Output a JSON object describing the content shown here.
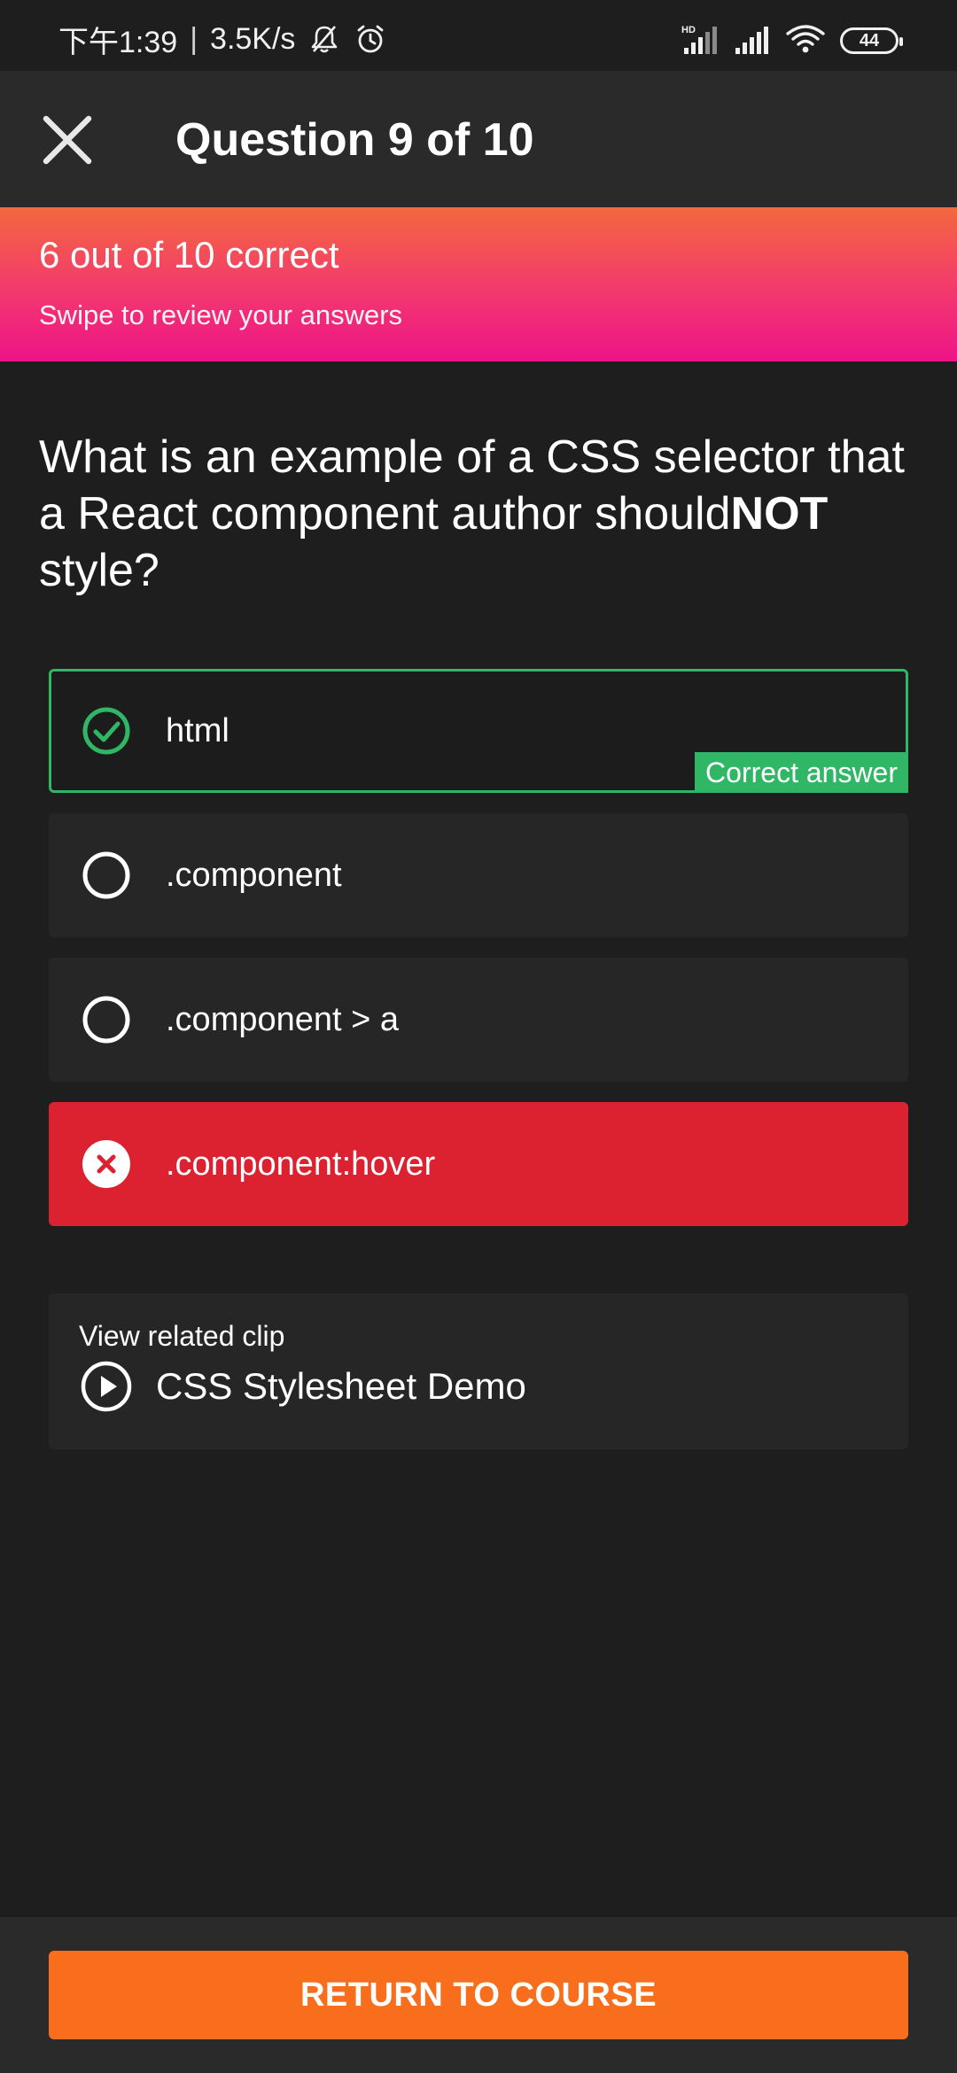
{
  "status_bar": {
    "time": "下午1:39",
    "separator": "|",
    "network_speed": "3.5K/s",
    "hd_label": "HD",
    "battery_level": "44",
    "icons": [
      "bell-muted-icon",
      "alarm-icon",
      "hd-signal-icon",
      "signal-icon",
      "wifi-icon",
      "battery-icon"
    ]
  },
  "header": {
    "title": "Question 9 of 10",
    "close_icon": "close-icon"
  },
  "score_banner": {
    "score_text": "6 out of 10 correct",
    "subtitle": "Swipe to review your answers"
  },
  "question": {
    "text_before": "What is an example of a CSS selector that a React component author should",
    "emphasis": "NOT",
    "text_after": " style?"
  },
  "answers": [
    {
      "label": "html",
      "state": "correct",
      "tag": "Correct answer",
      "icon": "check-circle-icon"
    },
    {
      "label": ".component",
      "state": "unselected",
      "icon": "radio-empty-icon"
    },
    {
      "label": ".component > a",
      "state": "unselected",
      "icon": "radio-empty-icon"
    },
    {
      "label": ".component:hover",
      "state": "wrong",
      "icon": "x-circle-icon"
    }
  ],
  "related_clip": {
    "caption": "View related clip",
    "title": "CSS Stylesheet Demo",
    "icon": "play-circle-icon"
  },
  "footer": {
    "button_label": "RETURN TO COURSE"
  },
  "colors": {
    "background": "#1e1e1e",
    "header_bg": "#2a2a2a",
    "card_bg": "#262626",
    "correct_green": "#2fb766",
    "wrong_red": "#dc2230",
    "accent_orange": "#f96e1c",
    "banner_gradient_top": "#f4683e",
    "banner_gradient_bottom": "#ee1389"
  }
}
